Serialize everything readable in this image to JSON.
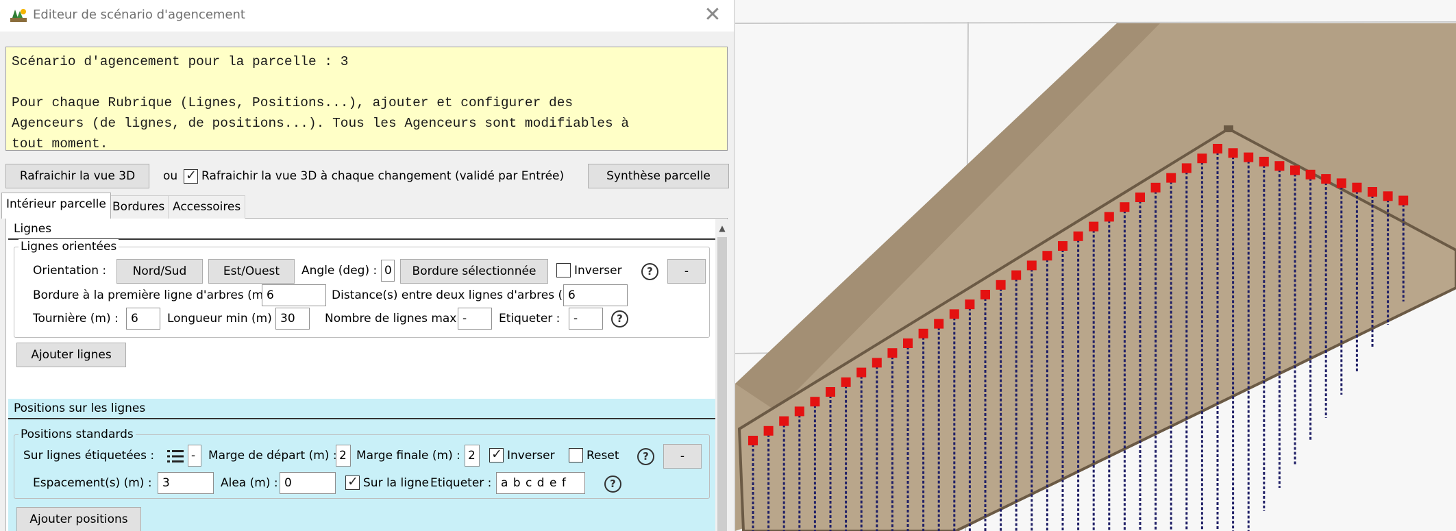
{
  "window": {
    "title": "Editeur de scénario d'agencement",
    "close_glyph": "✕",
    "icon": "app-icon"
  },
  "info": {
    "line1": "Scénario d'agencement pour la parcelle : 3",
    "line2": "Pour chaque Rubrique (Lignes, Positions...), ajouter et configurer des",
    "line3": "Agenceurs (de lignes, de positions...). Tous les Agenceurs sont modifiables à",
    "line4": "tout moment."
  },
  "toolbar": {
    "refresh_label": "Rafraichir la vue 3D",
    "or_label": "ou",
    "auto_refresh_label": "Rafraichir la vue 3D à chaque changement (validé par Entrée)",
    "auto_refresh_checked": true,
    "synthesis_label": "Synthèse parcelle"
  },
  "tabs": [
    {
      "label": "Intérieur parcelle",
      "active": true
    },
    {
      "label": "Bordures",
      "active": false
    },
    {
      "label": "Accessoires",
      "active": false
    }
  ],
  "lignes": {
    "header": "Lignes",
    "group_title": "Lignes orientées",
    "orientation_label": "Orientation :",
    "nord_sud_label": "Nord/Sud",
    "est_ouest_label": "Est/Ouest",
    "angle_label": "Angle (deg) :",
    "angle_value": "0",
    "bordure_sel_label": "Bordure sélectionnée",
    "inverser_label": "Inverser",
    "inverser_checked": false,
    "help_glyph": "?",
    "remove_label": "-",
    "bordure_first_label": "Bordure à la première ligne d'arbres (m) :",
    "bordure_first_value": "6",
    "distance_label": "Distance(s) entre deux lignes d'arbres (m) :",
    "distance_value": "6",
    "tourniere_label": "Tournière (m) :",
    "tourniere_value": "6",
    "longueur_label": "Longueur min (m) :",
    "longueur_value": "30",
    "nb_lignes_label": "Nombre de lignes max :",
    "nb_lignes_value": "-",
    "etiqueter_label": "Etiqueter :",
    "etiqueter_value": "-",
    "add_label": "Ajouter lignes"
  },
  "positions": {
    "header": "Positions sur les lignes",
    "group_title": "Positions standards",
    "sur_lignes_label": "Sur lignes étiquetées :",
    "list_icon": "list-icon",
    "sur_lignes_value": "-",
    "marge_depart_label": "Marge de départ (m) :",
    "marge_depart_value": "2",
    "marge_finale_label": "Marge finale (m) :",
    "marge_finale_value": "2",
    "inverser_label": "Inverser",
    "inverser_checked": true,
    "reset_label": "Reset",
    "reset_checked": false,
    "help_glyph": "?",
    "remove_label": "-",
    "espacement_label": "Espacement(s) (m) :",
    "espacement_value": "3",
    "alea_label": "Alea (m) :",
    "alea_value": "0",
    "sur_la_ligne_label": "Sur la ligne",
    "sur_la_ligne_checked": true,
    "etiqueter_label": "Etiqueter :",
    "etiqueter_value": "a b c d e f",
    "add_label": "Ajouter positions"
  },
  "scene": {
    "ground_color": "#b19d82",
    "marker_color": "#e41111",
    "row_color": "#1f1f66",
    "row_count": 43
  }
}
